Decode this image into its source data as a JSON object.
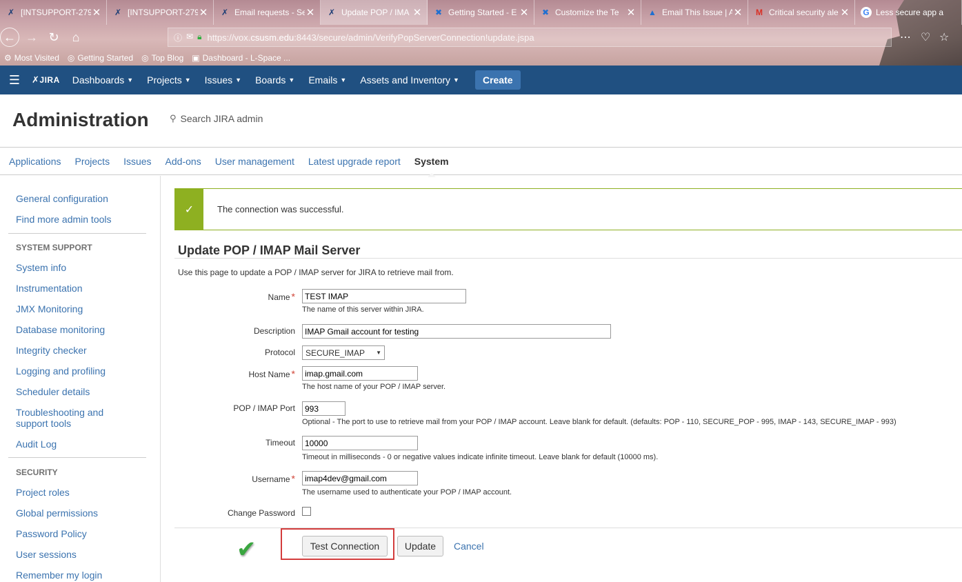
{
  "browser": {
    "tabs": [
      {
        "title": "[INTSUPPORT-279",
        "icon": "jira-icon",
        "active": false
      },
      {
        "title": "[INTSUPPORT-279",
        "icon": "jira-icon",
        "active": false
      },
      {
        "title": "Email requests - Se",
        "icon": "jira-icon",
        "active": false
      },
      {
        "title": "Update POP / IMA",
        "icon": "jira-icon",
        "active": true
      },
      {
        "title": "Getting Started - E",
        "icon": "confluence-icon",
        "active": false
      },
      {
        "title": "Customize the Te",
        "icon": "confluence-icon",
        "active": false
      },
      {
        "title": "Email This Issue | A",
        "icon": "atlassian-icon",
        "active": false
      },
      {
        "title": "Critical security ale",
        "icon": "gmail-icon",
        "active": false
      },
      {
        "title": "Less secure app a",
        "icon": "google-icon",
        "active": false
      }
    ],
    "url_prefix": "https://vox.",
    "url_domain": "csusm.edu",
    "url_suffix": ":8443/secure/admin/VerifyPopServerConnection!update.jspa",
    "bookmarks": [
      "Most Visited",
      "Getting Started",
      "Top Blog",
      "Dashboard - L-Space ..."
    ]
  },
  "jira": {
    "logo": "JIRA",
    "nav": [
      "Dashboards",
      "Projects",
      "Issues",
      "Boards",
      "Emails",
      "Assets and Inventory"
    ],
    "create": "Create"
  },
  "admin": {
    "title": "Administration",
    "search_placeholder": "Search JIRA admin",
    "tabs": [
      "Applications",
      "Projects",
      "Issues",
      "Add-ons",
      "User management",
      "Latest upgrade report",
      "System"
    ],
    "active_tab": "System"
  },
  "sidebar": {
    "top_links": [
      "General configuration",
      "Find more admin tools"
    ],
    "system_support_heading": "SYSTEM SUPPORT",
    "system_support_links": [
      "System info",
      "Instrumentation",
      "JMX Monitoring",
      "Database monitoring",
      "Integrity checker",
      "Logging and profiling",
      "Scheduler details",
      "Troubleshooting and support tools",
      "Audit Log"
    ],
    "security_heading": "SECURITY",
    "security_links": [
      "Project roles",
      "Global permissions",
      "Password Policy",
      "User sessions",
      "Remember my login"
    ]
  },
  "message": {
    "text": "The connection was successful."
  },
  "form": {
    "title": "Update POP / IMAP Mail Server",
    "description": "Use this page to update a POP / IMAP server for JIRA to retrieve mail from.",
    "name_label": "Name",
    "name_value": "TEST IMAP",
    "name_help": "The name of this server within JIRA.",
    "description_label": "Description",
    "description_value": "IMAP Gmail account for testing",
    "protocol_label": "Protocol",
    "protocol_value": "SECURE_IMAP",
    "host_label": "Host Name",
    "host_value": "imap.gmail.com",
    "host_help": "The host name of your POP / IMAP server.",
    "port_label": "POP / IMAP Port",
    "port_value": "993",
    "port_help": "Optional - The port to use to retrieve mail from your POP / IMAP account. Leave blank for default. (defaults: POP - 110, SECURE_POP - 995, IMAP - 143, SECURE_IMAP - 993)",
    "timeout_label": "Timeout",
    "timeout_value": "10000",
    "timeout_help": "Timeout in milliseconds - 0 or negative values indicate infinite timeout. Leave blank for default (10000 ms).",
    "username_label": "Username",
    "username_value": "imap4dev@gmail.com",
    "username_help": "The username used to authenticate your POP / IMAP account.",
    "change_password_label": "Change Password",
    "change_password_checked": false,
    "required_mark": "*"
  },
  "buttons": {
    "test_connection": "Test Connection",
    "update": "Update",
    "cancel": "Cancel"
  },
  "colors": {
    "jira_header": "#205081",
    "link": "#3b73af",
    "success": "#8eb021",
    "required": "#d04437",
    "highlight": "#d33c3c"
  }
}
